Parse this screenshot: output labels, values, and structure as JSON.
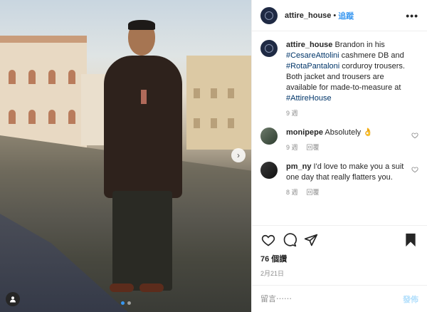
{
  "post": {
    "username": "attire_house",
    "separator": "•",
    "follow_label": "追蹤",
    "more_label": "•••"
  },
  "caption": {
    "username": "attire_house",
    "parts": [
      {
        "text": " Brandon in his ",
        "tag": false
      },
      {
        "text": "#CesareAttolini",
        "tag": true
      },
      {
        "text": " cashmere DB and ",
        "tag": false
      },
      {
        "text": "#RotaPantaloni",
        "tag": true
      },
      {
        "text": " corduroy trousers. Both jacket and trousers are available for made-to-measure at ",
        "tag": false
      },
      {
        "text": "#AttireHouse",
        "tag": true
      }
    ],
    "time": "9 週"
  },
  "comments": [
    {
      "username": "monipepe",
      "text": "Absolutely 👌",
      "time": "9 週",
      "reply_label": "回覆",
      "avatar": "monipepe"
    },
    {
      "username": "pm_ny",
      "text": "I'd love to make you a suit one day that really flatters you.",
      "time": "8 週",
      "reply_label": "回覆",
      "avatar": "pmny"
    }
  ],
  "likes": "76 個讚",
  "date": "2月21日",
  "add_comment": {
    "placeholder": "留言⋯⋯",
    "post_label": "發佈"
  },
  "carousel": {
    "total": 2,
    "active": 1
  },
  "colors": {
    "link": "#3897f0",
    "hashtag": "#003569",
    "muted": "#8e8e8e",
    "avatar_bg": "#1f2a44"
  },
  "icons": [
    "heart-icon",
    "comment-icon",
    "share-icon",
    "bookmark-icon",
    "chevron-right-icon",
    "user-tag-icon",
    "more-options-icon"
  ]
}
